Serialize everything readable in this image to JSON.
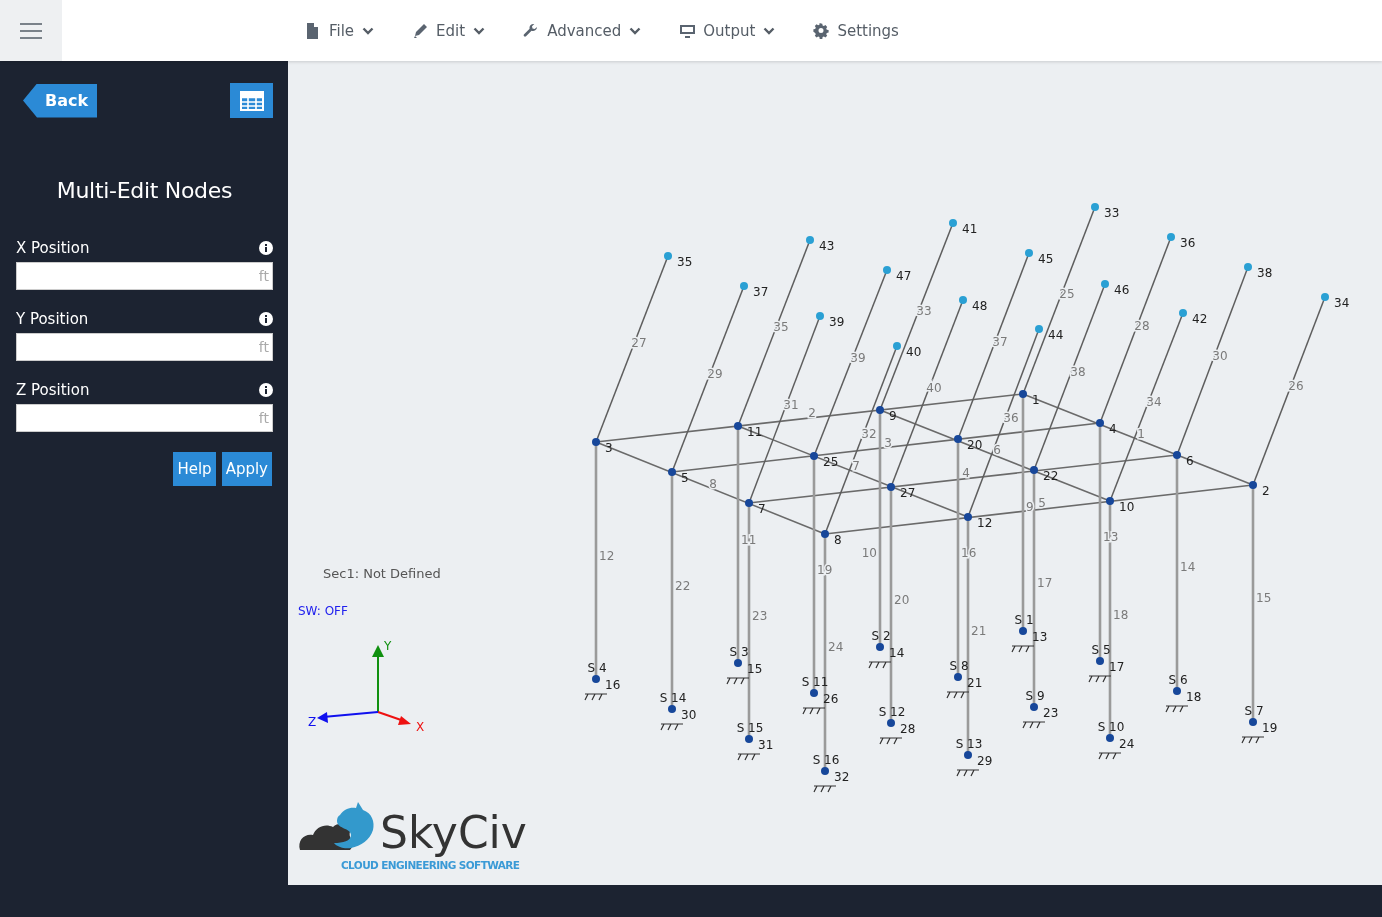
{
  "topbar": {
    "menu": [
      {
        "label": "File",
        "dropdown": true
      },
      {
        "label": "Edit",
        "dropdown": true
      },
      {
        "label": "Advanced",
        "dropdown": true
      },
      {
        "label": "Output",
        "dropdown": true
      },
      {
        "label": "Settings",
        "dropdown": false
      }
    ]
  },
  "sidebar": {
    "back": "Back",
    "title": "Multi-Edit Nodes",
    "fields": [
      {
        "label": "X Position",
        "unit": "ft"
      },
      {
        "label": "Y Position",
        "unit": "ft"
      },
      {
        "label": "Z Position",
        "unit": "ft"
      }
    ],
    "buttons": [
      "Help",
      "Apply"
    ]
  },
  "canvas": {
    "section": "Sec1: Not Defined",
    "self_weight": "SW: OFF",
    "axes": [
      "Y",
      "X",
      "Z"
    ],
    "logo": {
      "name": "SkyCiv",
      "tagline": "CLOUD ENGINEERING SOFTWARE"
    },
    "nodes": [
      {
        "label": "1",
        "kind": "frame"
      },
      {
        "label": "2",
        "kind": "frame"
      },
      {
        "label": "3",
        "kind": "frame"
      },
      {
        "label": "4",
        "kind": "frame"
      },
      {
        "label": "5",
        "kind": "frame"
      },
      {
        "label": "6",
        "kind": "frame"
      },
      {
        "label": "7",
        "kind": "frame"
      },
      {
        "label": "8",
        "kind": "frame"
      },
      {
        "label": "9",
        "kind": "frame"
      },
      {
        "label": "10",
        "kind": "frame"
      },
      {
        "label": "11",
        "kind": "frame"
      },
      {
        "label": "12",
        "kind": "frame"
      },
      {
        "label": "13",
        "kind": "support",
        "support": "S 1"
      },
      {
        "label": "14",
        "kind": "support",
        "support": "S 2"
      },
      {
        "label": "15",
        "kind": "support",
        "support": "S 3"
      },
      {
        "label": "16",
        "kind": "support",
        "support": "S 4"
      },
      {
        "label": "17",
        "kind": "support",
        "support": "S 5"
      },
      {
        "label": "18",
        "kind": "support",
        "support": "S 6"
      },
      {
        "label": "19",
        "kind": "support",
        "support": "S 7"
      },
      {
        "label": "20",
        "kind": "frame"
      },
      {
        "label": "21",
        "kind": "support",
        "support": "S 8"
      },
      {
        "label": "22",
        "kind": "frame"
      },
      {
        "label": "23",
        "kind": "support",
        "support": "S 9"
      },
      {
        "label": "24",
        "kind": "support",
        "support": "S 10"
      },
      {
        "label": "25",
        "kind": "frame"
      },
      {
        "label": "26",
        "kind": "support",
        "support": "S 11"
      },
      {
        "label": "27",
        "kind": "frame"
      },
      {
        "label": "28",
        "kind": "support",
        "support": "S 12"
      },
      {
        "label": "29",
        "kind": "support",
        "support": "S 13"
      },
      {
        "label": "30",
        "kind": "support",
        "support": "S 14"
      },
      {
        "label": "31",
        "kind": "support",
        "support": "S 15"
      },
      {
        "label": "32",
        "kind": "support",
        "support": "S 16"
      },
      {
        "label": "33",
        "kind": "top"
      },
      {
        "label": "34",
        "kind": "top"
      },
      {
        "label": "35",
        "kind": "top"
      },
      {
        "label": "36",
        "kind": "top"
      },
      {
        "label": "37",
        "kind": "top"
      },
      {
        "label": "38",
        "kind": "top"
      },
      {
        "label": "39",
        "kind": "top"
      },
      {
        "label": "40",
        "kind": "top"
      },
      {
        "label": "41",
        "kind": "top"
      },
      {
        "label": "42",
        "kind": "top"
      },
      {
        "label": "43",
        "kind": "top"
      },
      {
        "label": "44",
        "kind": "top"
      },
      {
        "label": "45",
        "kind": "top"
      },
      {
        "label": "46",
        "kind": "top"
      },
      {
        "label": "47",
        "kind": "top"
      },
      {
        "label": "48",
        "kind": "top"
      }
    ],
    "members": [
      {
        "label": "1",
        "kind": "beam"
      },
      {
        "label": "2",
        "kind": "beam"
      },
      {
        "label": "3",
        "kind": "beam"
      },
      {
        "label": "4",
        "kind": "beam"
      },
      {
        "label": "5",
        "kind": "beam"
      },
      {
        "label": "6",
        "kind": "beam"
      },
      {
        "label": "7",
        "kind": "beam"
      },
      {
        "label": "8",
        "kind": "beam"
      },
      {
        "label": "9",
        "kind": "column"
      },
      {
        "label": "10",
        "kind": "column"
      },
      {
        "label": "11",
        "kind": "column"
      },
      {
        "label": "12",
        "kind": "column"
      },
      {
        "label": "13",
        "kind": "column"
      },
      {
        "label": "14",
        "kind": "column"
      },
      {
        "label": "15",
        "kind": "column"
      },
      {
        "label": "16",
        "kind": "column"
      },
      {
        "label": "17",
        "kind": "column"
      },
      {
        "label": "18",
        "kind": "column"
      },
      {
        "label": "19",
        "kind": "column"
      },
      {
        "label": "20",
        "kind": "column"
      },
      {
        "label": "21",
        "kind": "column"
      },
      {
        "label": "22",
        "kind": "column"
      },
      {
        "label": "23",
        "kind": "column"
      },
      {
        "label": "24",
        "kind": "column"
      },
      {
        "label": "25",
        "kind": "brace"
      },
      {
        "label": "26",
        "kind": "brace"
      },
      {
        "label": "27",
        "kind": "brace"
      },
      {
        "label": "28",
        "kind": "brace"
      },
      {
        "label": "29",
        "kind": "brace"
      },
      {
        "label": "30",
        "kind": "brace"
      },
      {
        "label": "31",
        "kind": "brace"
      },
      {
        "label": "32",
        "kind": "brace"
      },
      {
        "label": "33",
        "kind": "brace"
      },
      {
        "label": "34",
        "kind": "brace"
      },
      {
        "label": "35",
        "kind": "brace"
      },
      {
        "label": "36",
        "kind": "brace"
      },
      {
        "label": "37",
        "kind": "brace"
      },
      {
        "label": "38",
        "kind": "brace"
      },
      {
        "label": "39",
        "kind": "brace"
      },
      {
        "label": "40",
        "kind": "brace"
      }
    ]
  }
}
